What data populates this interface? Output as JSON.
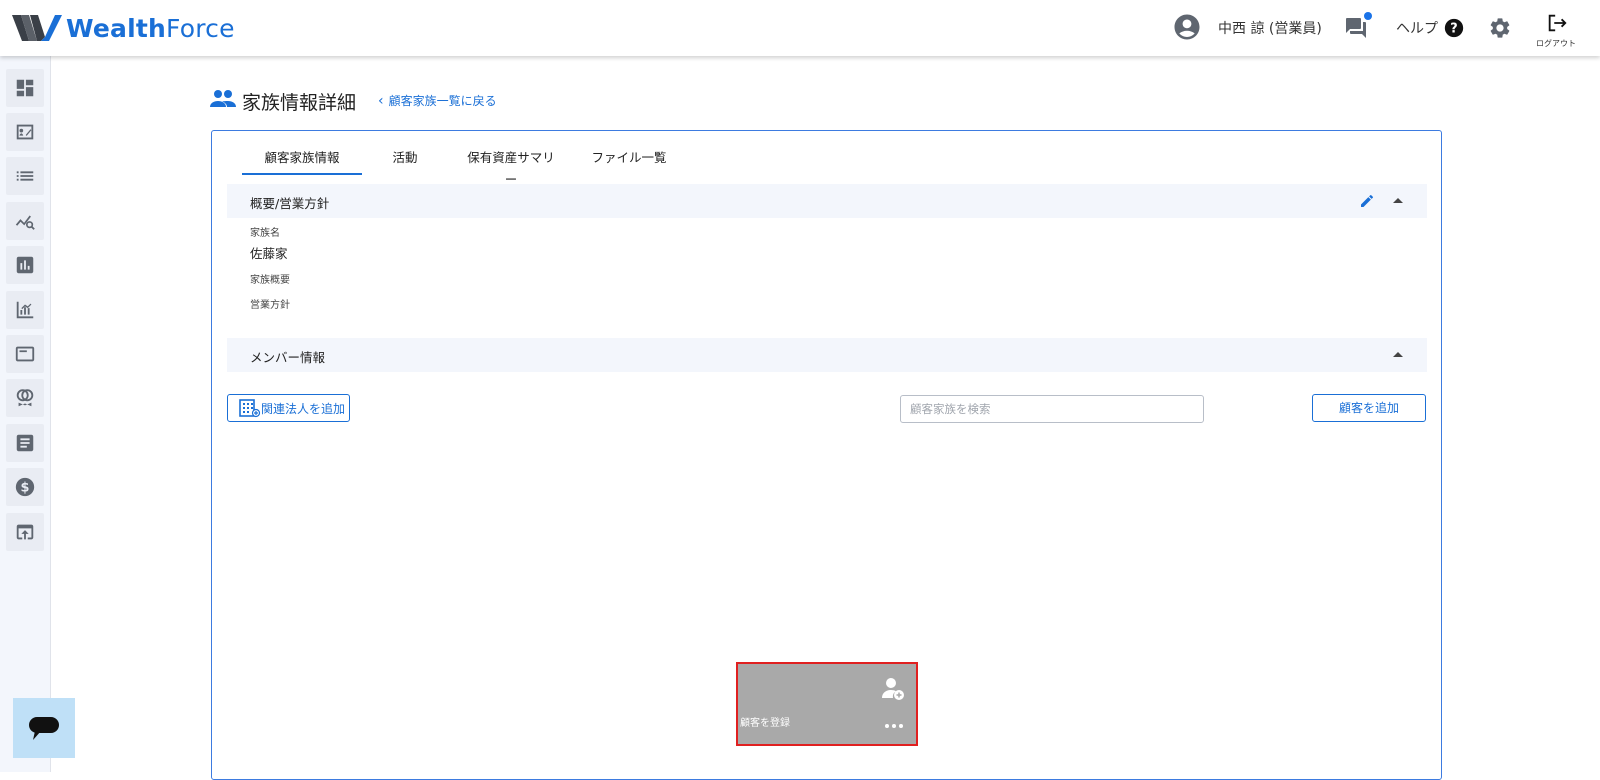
{
  "header": {
    "logo_bold": "Wealth",
    "logo_light": "Force",
    "username": "中西 諒 (営業員)",
    "help_label": "ヘルプ",
    "logout_label": "ログアウト"
  },
  "sidebar": {
    "items": [
      {
        "icon": "dashboard-icon"
      },
      {
        "icon": "contact-card-icon"
      },
      {
        "icon": "list-icon"
      },
      {
        "icon": "trend-search-icon"
      },
      {
        "icon": "bar-chart-icon"
      },
      {
        "icon": "analytics-icon"
      },
      {
        "icon": "panel-icon"
      },
      {
        "icon": "rings-icon"
      },
      {
        "icon": "document-icon"
      },
      {
        "icon": "dollar-icon"
      },
      {
        "icon": "upload-window-icon"
      }
    ]
  },
  "page": {
    "title": "家族情報詳細",
    "back_link": "顧客家族一覧に戻る"
  },
  "tabs": [
    {
      "label": "顧客家族情報",
      "active": true
    },
    {
      "label": "活動",
      "active": false
    },
    {
      "label": "保有資産サマリー",
      "active": false
    },
    {
      "label": "ファイル一覧",
      "active": false
    }
  ],
  "overview": {
    "section_title": "概要/営業方針",
    "family_name_label": "家族名",
    "family_name_value": "佐藤家",
    "family_summary_label": "家族概要",
    "sales_policy_label": "営業方針"
  },
  "members": {
    "section_title": "メンバー情報",
    "add_corp_label": "関連法人を追加",
    "search_placeholder": "顧客家族を検索",
    "add_customer_label": "顧客を追加",
    "register_card_label": "顧客を登録"
  },
  "colors": {
    "accent": "#1a6fd6",
    "section_bg": "#f3f6fc",
    "highlight_border": "#e02020",
    "card_bg": "#a9a9a9"
  }
}
